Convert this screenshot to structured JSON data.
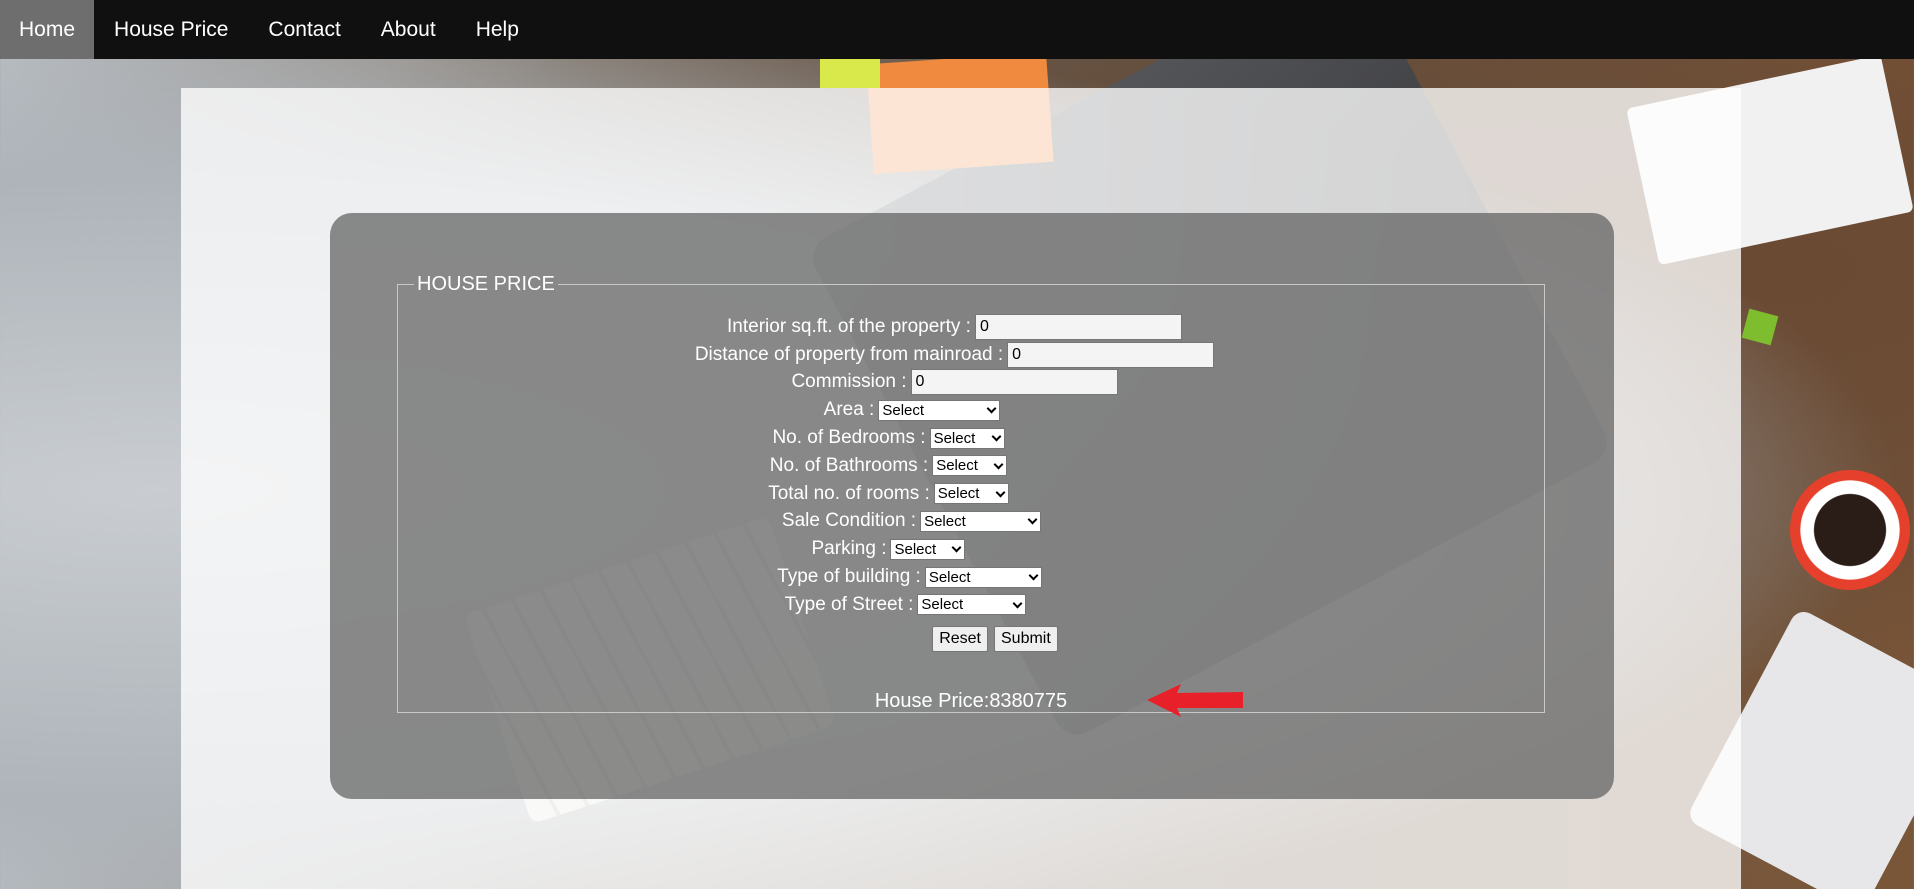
{
  "nav": {
    "items": [
      {
        "label": "Home",
        "active": true
      },
      {
        "label": "House Price",
        "active": false
      },
      {
        "label": "Contact",
        "active": false
      },
      {
        "label": "About",
        "active": false
      },
      {
        "label": "Help",
        "active": false
      }
    ]
  },
  "form": {
    "legend": "HOUSE PRICE",
    "fields": [
      {
        "label": "Interior sq.ft. of the property :",
        "type": "text",
        "value": "0"
      },
      {
        "label": "Distance of property from mainroad :",
        "type": "text",
        "value": "0"
      },
      {
        "label": "Commission :",
        "type": "text",
        "value": "0"
      },
      {
        "label": "Area :",
        "type": "select",
        "value": "Select"
      },
      {
        "label": "No. of Bedrooms :",
        "type": "select",
        "value": "Select"
      },
      {
        "label": "No. of Bathrooms :",
        "type": "select",
        "value": "Select"
      },
      {
        "label": "Total no. of rooms :",
        "type": "select",
        "value": "Select"
      },
      {
        "label": "Sale Condition :",
        "type": "select",
        "value": "Select"
      },
      {
        "label": "Parking :",
        "type": "select",
        "value": "Select"
      },
      {
        "label": "Type of building :",
        "type": "select",
        "value": "Select"
      },
      {
        "label": "Type of Street :",
        "type": "select",
        "value": "Select"
      }
    ],
    "reset_label": "Reset",
    "submit_label": "Submit",
    "result_label": "House Price:",
    "result_value": "8380775"
  },
  "colors": {
    "navbar": "#101010",
    "nav_active": "#6e6e6e",
    "annotation_arrow": "#e8202a"
  },
  "icons": {
    "annotation": "red-arrow-pointing-left"
  }
}
